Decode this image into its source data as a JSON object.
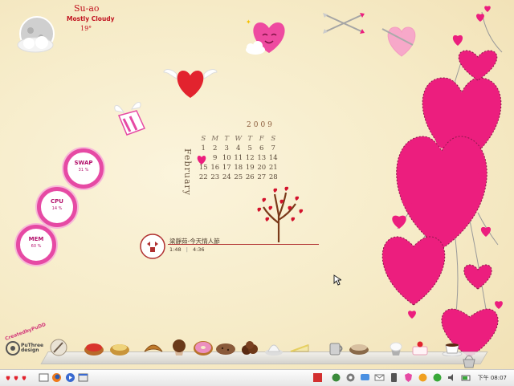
{
  "weather": {
    "city": "Su-ao",
    "condition": "Mostly Cloudy",
    "temperature": "19°"
  },
  "gauges": [
    {
      "label": "SWAP",
      "value": "31 %"
    },
    {
      "label": "CPU",
      "value": "14 %"
    },
    {
      "label": "MEM",
      "value": "60 %"
    }
  ],
  "calendar": {
    "year": "2009",
    "month": "February",
    "weekday_headers": [
      "S",
      "M",
      "T",
      "W",
      "T",
      "F",
      "S"
    ],
    "rows": [
      [
        "1",
        "2",
        "3",
        "4",
        "5",
        "6",
        "7"
      ],
      [
        "8",
        "9",
        "10",
        "11",
        "12",
        "13",
        "14"
      ],
      [
        "15",
        "16",
        "17",
        "18",
        "19",
        "20",
        "21"
      ],
      [
        "22",
        "23",
        "24",
        "25",
        "26",
        "27",
        "28"
      ]
    ],
    "highlighted_day": "8"
  },
  "music": {
    "title": "梁靜茹-今天情人節",
    "elapsed": "1:48",
    "total": "4:36"
  },
  "dock": {
    "icons": [
      "tools-icon",
      "pie-icon",
      "tart-icon",
      "croissant-icon",
      "muffin-icon",
      "donut-icon",
      "cookie-icon",
      "chocolate-icon",
      "pudding-icon",
      "cake-slice-icon",
      "coffee-pot-icon",
      "cookies-tin-icon",
      "cupcake-icon",
      "strawberry-cake-icon",
      "coffee-cup-icon"
    ],
    "brand_lines": [
      "PuThree",
      "design"
    ],
    "credit": "CreatedbyPuDD"
  },
  "taskbar": {
    "clock": "下午 08:07"
  },
  "colors": {
    "accent_pink": "#e64aa4",
    "heart_pink": "#ec1e7e",
    "text_red": "#c1121f",
    "background": "#f6ecc8"
  }
}
